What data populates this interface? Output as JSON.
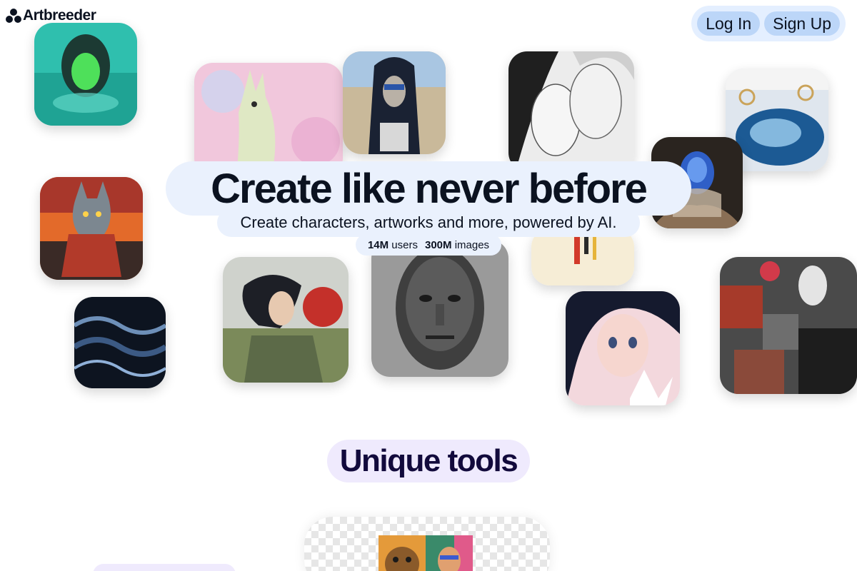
{
  "header": {
    "brand": "Artbreeder",
    "login_label": "Log In",
    "signup_label": "Sign Up"
  },
  "hero": {
    "title": "Create like never before",
    "subtitle": "Create characters, artworks and more, powered by AI.",
    "stats": [
      {
        "value": "14M",
        "label": "users"
      },
      {
        "value": "300M",
        "label": "images"
      }
    ]
  },
  "sections": {
    "tools_title": "Unique tools"
  },
  "colors": {
    "pill_bg": "#eaf1fd",
    "auth_bg": "#e4efff",
    "auth_btn": "#bcd6f8",
    "section_pill": "#efeafd",
    "text": "#0b1220"
  },
  "gallery": [
    "woman-in-green-water",
    "pastel-llama",
    "masked-figure",
    "sketched-faces",
    "ocean-table",
    "blue-cosmic-figure",
    "cat-warrior",
    "woman-in-wind",
    "stone-face",
    "dripping-paint",
    "anime-girl-with-lotus",
    "collage-woman",
    "dark-waves"
  ]
}
